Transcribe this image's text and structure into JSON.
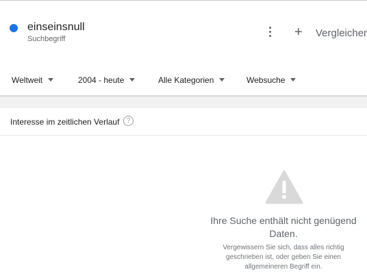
{
  "term": {
    "name": "einseinsnull",
    "type": "Suchbegriff",
    "color": "#1a73e8"
  },
  "actions": {
    "more_icon": "more-vert-icon",
    "compare_symbol": "+",
    "compare_label": "Vergleichen"
  },
  "filters": {
    "region": "Weltweit",
    "time": "2004 - heute",
    "category": "Alle Kategorien",
    "search_type": "Websuche"
  },
  "section": {
    "title": "Interesse im zeitlichen Verlauf",
    "help_symbol": "?"
  },
  "empty_state": {
    "icon": "warning-icon",
    "title": "Ihre Suche enthält nicht genügend Daten.",
    "body": "Vergewissern Sie sich, dass alles richtig geschrieben ist, oder geben Sie einen allgemeineren Begriff ein."
  }
}
